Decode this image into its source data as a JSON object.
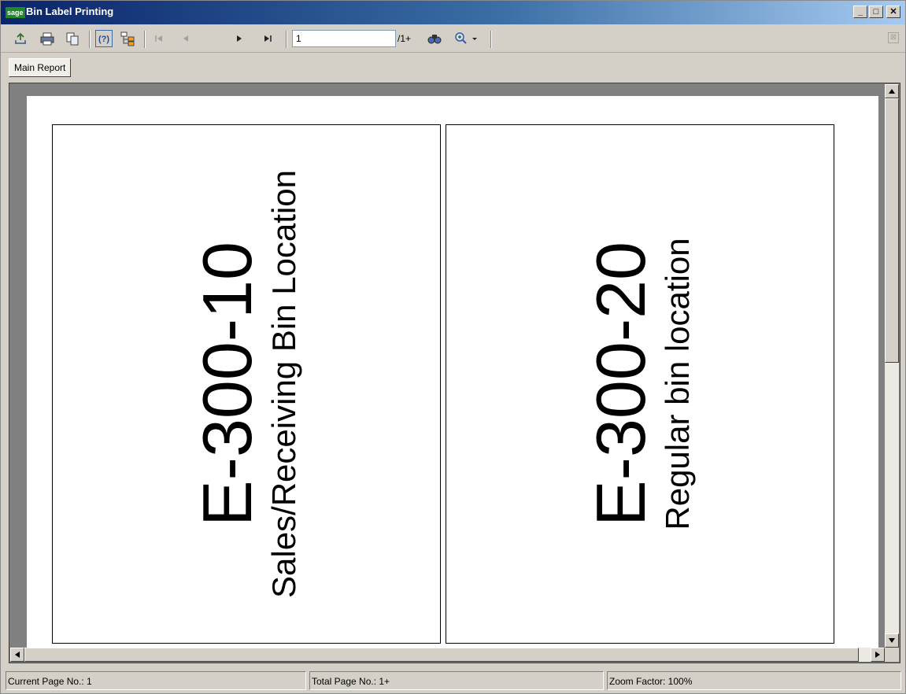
{
  "window": {
    "title": "Bin Label Printing",
    "app_badge": "sage",
    "controls": {
      "minimize": "_",
      "maximize": "□",
      "close": "✕"
    }
  },
  "toolbar": {
    "icons": [
      "export-icon",
      "print-icon",
      "copy-icon",
      "help-icon",
      "group-tree-icon",
      "first-page-icon",
      "previous-page-icon",
      "next-page-icon",
      "last-page-icon",
      "search-text-icon",
      "zoom-icon"
    ],
    "page_input_value": "1",
    "page_total_text": "/1+",
    "close_glyph": "⊠"
  },
  "tabs": [
    {
      "label": "Main Report"
    }
  ],
  "report": {
    "labels": [
      {
        "bin_code": "E-300-10",
        "description": "Sales/Receiving Bin Location"
      },
      {
        "bin_code": "E-300-20",
        "description": "Regular bin location"
      }
    ]
  },
  "statusbar": {
    "current_page": "Current Page No.: 1",
    "total_page": "Total Page No.: 1+",
    "zoom": "Zoom Factor: 100%"
  },
  "colors": {
    "titlebar_start": "#0a246a",
    "titlebar_end": "#a6caf0",
    "window_face": "#d4d0c8",
    "report_background": "#808080",
    "sage_logo": "#1f8a2a"
  }
}
